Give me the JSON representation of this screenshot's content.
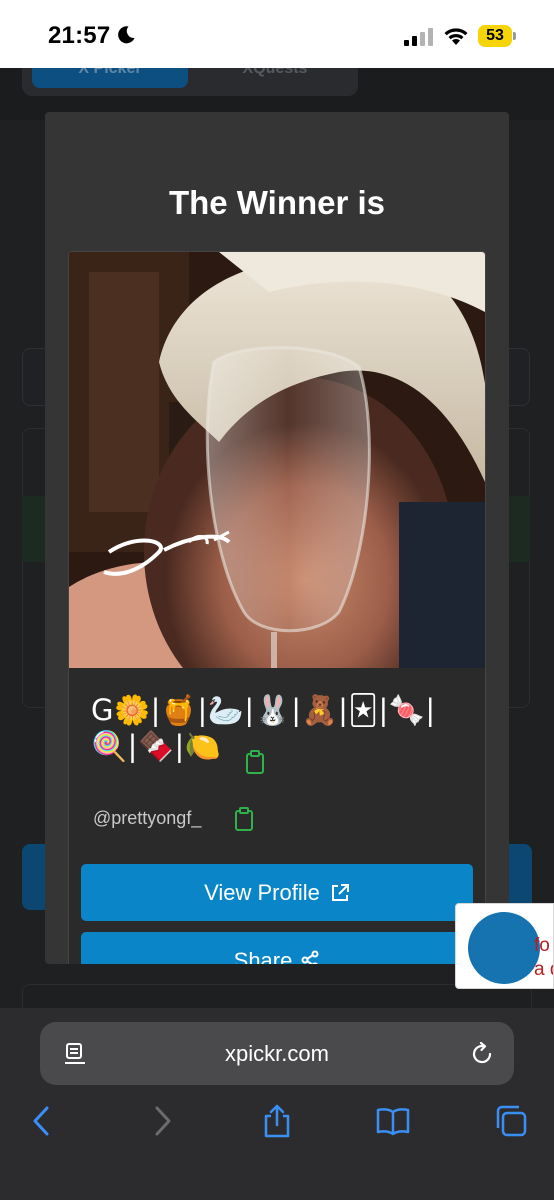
{
  "status_bar": {
    "time": "21:57",
    "battery": "53"
  },
  "background_page": {
    "tab_active": "X Picker",
    "tab_inactive": "XQuests"
  },
  "modal": {
    "title": "The Winner is",
    "winner": {
      "display_name": "G🌼|🍯|🦢|🐰|🧸|🃏|🍬|🍭|🍫|🍋",
      "handle": "@prettyongf_"
    },
    "buttons": {
      "view_profile": "View Profile",
      "share": "Share"
    }
  },
  "side_popup": {
    "text_line1": "fo",
    "text_line2": "a do"
  },
  "browser": {
    "url": "xpickr.com"
  },
  "colors": {
    "accent": "#0a86c8",
    "modal_bg": "#353535",
    "copy_icon": "#2fb24a",
    "battery": "#f5d50a"
  },
  "icons": [
    "moon-icon",
    "cellular-signal-icon",
    "wifi-icon",
    "copy-icon",
    "external-link-icon",
    "share-icon",
    "reader-icon",
    "reload-icon",
    "back-icon",
    "forward-icon",
    "share-sheet-icon",
    "bookmarks-icon",
    "tabs-icon"
  ]
}
